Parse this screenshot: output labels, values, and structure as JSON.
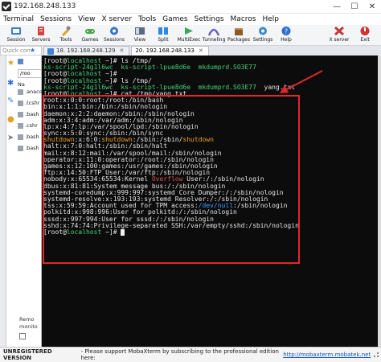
{
  "window": {
    "title": "192.168.248.133",
    "min": "—",
    "max": "☐",
    "close": "✕"
  },
  "menu": [
    "Terminal",
    "Sessions",
    "View",
    "X server",
    "Tools",
    "Games",
    "Settings",
    "Macros",
    "Help"
  ],
  "toolbar": [
    {
      "label": "Session",
      "icon": "session-icon",
      "color": "#3d7bd9"
    },
    {
      "label": "Servers",
      "icon": "servers-icon",
      "color": "#d94040"
    },
    {
      "label": "Tools",
      "icon": "tools-icon",
      "color": "#d7a226"
    },
    {
      "label": "Games",
      "icon": "games-icon",
      "color": "#4aa84a"
    },
    {
      "label": "Sessions",
      "icon": "sessions-icon",
      "color": "#3572c6"
    },
    {
      "label": "View",
      "icon": "view-icon",
      "color": "#5a6b82"
    },
    {
      "label": "Split",
      "icon": "split-icon",
      "color": "#2e88e0"
    },
    {
      "label": "MultiExec",
      "icon": "multiexec-icon",
      "color": "#3da75a"
    },
    {
      "label": "Tunneling",
      "icon": "tunneling-icon",
      "color": "#6b5bc2"
    },
    {
      "label": "Packages",
      "icon": "packages-icon",
      "color": "#8a5a2b"
    },
    {
      "label": "Settings",
      "icon": "settings-icon",
      "color": "#3a8ad0"
    },
    {
      "label": "Help",
      "icon": "help-icon",
      "color": "#2e6dd1"
    },
    {
      "label": "X server",
      "icon": "xserver-icon",
      "color": "#c23a3a"
    },
    {
      "label": "Exit",
      "icon": "exit-icon",
      "color": "#d23030"
    }
  ],
  "quick_connect": {
    "placeholder": "Quick con"
  },
  "left_pane": {
    "path": "/roo",
    "files": [
      ".anaco",
      ".tcshr",
      ".bash",
      ".cshr",
      ".bash",
      ".bash"
    ],
    "remote_monitoring": "Remo\nmonito",
    "folder_label": "Na"
  },
  "tabs": [
    {
      "label": "18. 192.168.248.129",
      "active": false
    },
    {
      "label": "20. 192.168.248.133",
      "active": true
    }
  ],
  "terminal": {
    "lines": [
      [
        {
          "t": "[root@",
          "c": ""
        },
        {
          "t": "localhost",
          "c": "c-green"
        },
        {
          "t": " ~]# ls /tmp/",
          "c": ""
        }
      ],
      [
        {
          "t": "ks-script-24g1l6wc  ks-script-lpue8d6e  mkdumprd.SO3E77",
          "c": "c-green"
        }
      ],
      [
        {
          "t": "[root@",
          "c": ""
        },
        {
          "t": "localhost",
          "c": "c-green"
        },
        {
          "t": " ~]#",
          "c": ""
        }
      ],
      [
        {
          "t": "[root@",
          "c": ""
        },
        {
          "t": "localhost",
          "c": "c-green"
        },
        {
          "t": " ~]# ls /tmp/",
          "c": ""
        }
      ],
      [
        {
          "t": "ks-script-24g1l6wc  ks-script-lpue8d6e  mkdumprd.SO3E77",
          "c": "c-green"
        },
        {
          "t": "  yang.txt",
          "c": ""
        }
      ],
      [
        {
          "t": "[root@",
          "c": ""
        },
        {
          "t": "localhost",
          "c": "c-green"
        },
        {
          "t": " ~]# cat /tmp/yang.txt",
          "c": ""
        }
      ],
      [
        {
          "t": "root:x:0:0:root:/root:/bin/bash",
          "c": ""
        }
      ],
      [
        {
          "t": "bin:x:1:1:bin:/bin:/sbin/nologin",
          "c": ""
        }
      ],
      [
        {
          "t": "daemon:x:2:2:daemon:/sbin:/sbin/nologin",
          "c": ""
        }
      ],
      [
        {
          "t": "adm:x:3:4:adm:/var/adm:/sbin/nologin",
          "c": ""
        }
      ],
      [
        {
          "t": "lp:x:4:7:lp:/var/spool/lpd:/sbin/nologin",
          "c": ""
        }
      ],
      [
        {
          "t": "sync:x:5:0:sync:/sbin:/bin/sync",
          "c": ""
        }
      ],
      [
        {
          "t": "shutdown",
          "c": "c-orange"
        },
        {
          "t": ":x:6:0:",
          "c": ""
        },
        {
          "t": "shutdown",
          "c": "c-orange"
        },
        {
          "t": ":/sbin:/sbin/",
          "c": ""
        },
        {
          "t": "shutdown",
          "c": "c-orange"
        }
      ],
      [
        {
          "t": "halt:x:7:0:halt:/sbin:/sbin/halt",
          "c": ""
        }
      ],
      [
        {
          "t": "mail:x:8:12:mail:/var/spool/mail:/sbin/nologin",
          "c": ""
        }
      ],
      [
        {
          "t": "operator:x:11:0:operator:/root:/sbin/nologin",
          "c": ""
        }
      ],
      [
        {
          "t": "games:x:12:100:games:/usr/games:/sbin/nologin",
          "c": ""
        }
      ],
      [
        {
          "t": "ftp:x:14:50:FTP User:/var/ftp:/sbin/nologin",
          "c": ""
        }
      ],
      [
        {
          "t": "nobody:x:65534:65534:Kernel ",
          "c": ""
        },
        {
          "t": "Overflow",
          "c": "c-red"
        },
        {
          "t": " User:/:/sbin/nologin",
          "c": ""
        }
      ],
      [
        {
          "t": "dbus:x:81:81:System message bus:/:/sbin/nologin",
          "c": ""
        }
      ],
      [
        {
          "t": "systemd-coredump:x:999:997:systemd Core Dumper:/:/sbin/nologin",
          "c": ""
        }
      ],
      [
        {
          "t": "systemd-resolve:x:193:193:systemd Resolver:/:/sbin/nologin",
          "c": ""
        }
      ],
      [
        {
          "t": "tss:x:59:59:Account used for TPM access:",
          "c": ""
        },
        {
          "t": "/dev/null",
          "c": "c-blue"
        },
        {
          "t": ":/sbin/nologin",
          "c": ""
        }
      ],
      [
        {
          "t": "polkitd:x:998:996:User for polkitd:/:/sbin/nologin",
          "c": ""
        }
      ],
      [
        {
          "t": "sssd:x:997:994:User for sssd:/:/sbin/nologin",
          "c": ""
        }
      ],
      [
        {
          "t": "sshd:x:74:74:Privilege-separated SSH:/var/empty/sshd:/sbin/nologin",
          "c": ""
        }
      ],
      [
        {
          "t": "[root@",
          "c": ""
        },
        {
          "t": "localhost",
          "c": "c-green"
        },
        {
          "t": " ~]# ",
          "c": ""
        }
      ]
    ]
  },
  "statusbar": {
    "unregistered": "UNREGISTERED VERSION",
    "message": "-  Please support MobaXterm by subscribing to the professional edition here:",
    "link": "http://mobaxterm.mobatek.net"
  }
}
